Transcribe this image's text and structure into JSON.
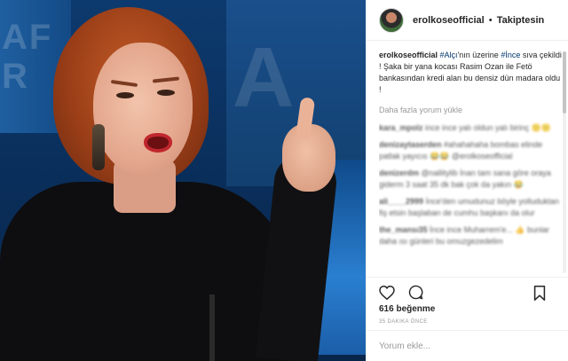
{
  "post": {
    "username": "erolkoseofficial",
    "separator": "•",
    "follow_label": "Takiptesin",
    "caption": {
      "username": "erolkoseofficial",
      "tag1": "#Alçı",
      "text1": "'nın üzerine ",
      "tag2": "#İnce",
      "text2": " sıva çekildi ! Şaka bir yana kocası Rasim Ozan ile Fetö bankasından kredi alan bu densiz dün madara oldu !"
    },
    "load_more_label": "Daha fazla yorum yükle",
    "comments": [
      {
        "user": "kara_mpolz",
        "text": "ince ince yalı oldun yalı birinç 🙁😕"
      },
      {
        "user": "denizaytaserden",
        "text": "#ahahahaha bombas elinde patlak yayıcıs 😂😂 @erolkoseofficial"
      },
      {
        "user": "denizerdm",
        "text": "@nallitylib İnan tam sana göre oraya giderm 3 saat 35 dk bak çok da yakın 😂"
      },
      {
        "user": "ali____2999",
        "text": "İnce'den umudunuz böyle yolluduktan fiş etsin başlaban de cumhu başkanı da olur"
      },
      {
        "user": "the_mansı35",
        "text": "İnce ince Muharrem'e... 👍 bunlar daha ısı günleri bu omuzgezedelim"
      }
    ],
    "likes": "616 beğenme",
    "timestamp": "35 DAKIKA ÖNCE",
    "comment_placeholder": "Yorum ekle..."
  },
  "photo": {
    "backdrop_text_left": "AF\nR",
    "backdrop_text_right": "A"
  },
  "icons": {
    "like": "heart-icon",
    "comment": "comment-icon",
    "save": "bookmark-icon"
  }
}
